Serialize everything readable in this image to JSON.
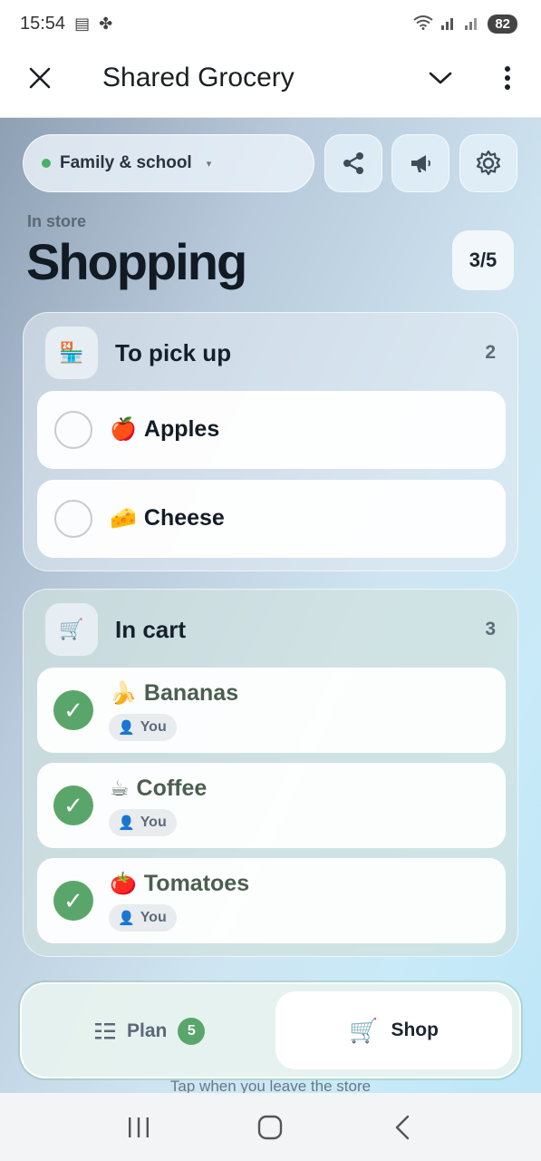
{
  "status_bar": {
    "time": "15:54",
    "battery": "82"
  },
  "app_bar": {
    "title": "Shared Grocery"
  },
  "header": {
    "list_chip": {
      "label": "Family & school",
      "caret": "▾"
    },
    "subtitle": "In store",
    "title": "Shopping",
    "progress": "3/5"
  },
  "sections": {
    "to_pick_up": {
      "title": "To pick up",
      "count": "2",
      "icon": "store-icon",
      "items": [
        {
          "emoji": "🍎",
          "name": "Apples"
        },
        {
          "emoji": "🧀",
          "name": "Cheese"
        }
      ]
    },
    "in_cart": {
      "title": "In cart",
      "count": "3",
      "icon": "cart-icon",
      "items": [
        {
          "emoji": "🍌",
          "name": "Bananas",
          "by": "You"
        },
        {
          "emoji": "☕",
          "name": "Coffee",
          "by": "You"
        },
        {
          "emoji": "🍅",
          "name": "Tomatoes",
          "by": "You"
        }
      ]
    }
  },
  "bottom_tabs": {
    "plan": {
      "label": "Plan",
      "badge": "5"
    },
    "shop": {
      "label": "Shop"
    }
  },
  "hint": "Tap when you leave the store",
  "colors": {
    "accent_green": "#5aa66a",
    "check_green": "#5aa66a",
    "title_text": "#121a24"
  }
}
